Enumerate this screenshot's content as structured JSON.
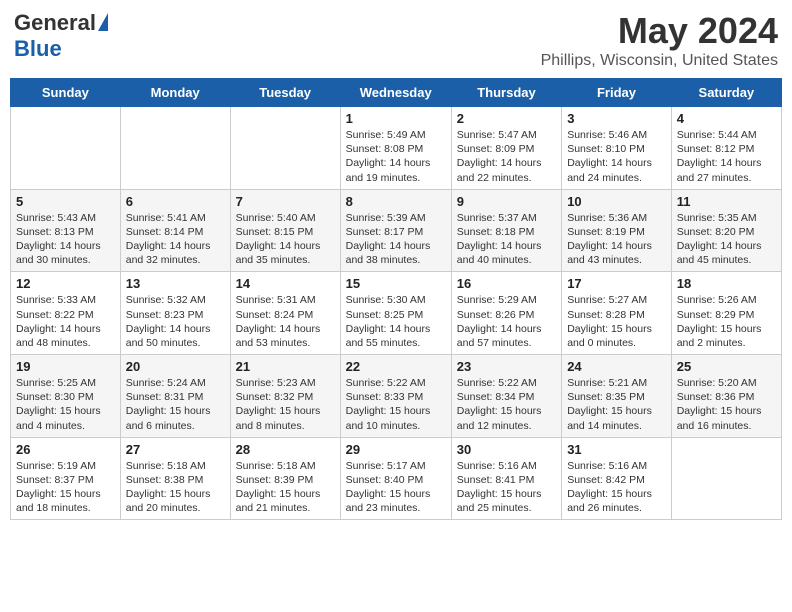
{
  "header": {
    "logo_general": "General",
    "logo_blue": "Blue",
    "month_year": "May 2024",
    "location": "Phillips, Wisconsin, United States"
  },
  "days_of_week": [
    "Sunday",
    "Monday",
    "Tuesday",
    "Wednesday",
    "Thursday",
    "Friday",
    "Saturday"
  ],
  "weeks": [
    [
      {
        "day": "",
        "info": ""
      },
      {
        "day": "",
        "info": ""
      },
      {
        "day": "",
        "info": ""
      },
      {
        "day": "1",
        "info": "Sunrise: 5:49 AM\nSunset: 8:08 PM\nDaylight: 14 hours and 19 minutes."
      },
      {
        "day": "2",
        "info": "Sunrise: 5:47 AM\nSunset: 8:09 PM\nDaylight: 14 hours and 22 minutes."
      },
      {
        "day": "3",
        "info": "Sunrise: 5:46 AM\nSunset: 8:10 PM\nDaylight: 14 hours and 24 minutes."
      },
      {
        "day": "4",
        "info": "Sunrise: 5:44 AM\nSunset: 8:12 PM\nDaylight: 14 hours and 27 minutes."
      }
    ],
    [
      {
        "day": "5",
        "info": "Sunrise: 5:43 AM\nSunset: 8:13 PM\nDaylight: 14 hours and 30 minutes."
      },
      {
        "day": "6",
        "info": "Sunrise: 5:41 AM\nSunset: 8:14 PM\nDaylight: 14 hours and 32 minutes."
      },
      {
        "day": "7",
        "info": "Sunrise: 5:40 AM\nSunset: 8:15 PM\nDaylight: 14 hours and 35 minutes."
      },
      {
        "day": "8",
        "info": "Sunrise: 5:39 AM\nSunset: 8:17 PM\nDaylight: 14 hours and 38 minutes."
      },
      {
        "day": "9",
        "info": "Sunrise: 5:37 AM\nSunset: 8:18 PM\nDaylight: 14 hours and 40 minutes."
      },
      {
        "day": "10",
        "info": "Sunrise: 5:36 AM\nSunset: 8:19 PM\nDaylight: 14 hours and 43 minutes."
      },
      {
        "day": "11",
        "info": "Sunrise: 5:35 AM\nSunset: 8:20 PM\nDaylight: 14 hours and 45 minutes."
      }
    ],
    [
      {
        "day": "12",
        "info": "Sunrise: 5:33 AM\nSunset: 8:22 PM\nDaylight: 14 hours and 48 minutes."
      },
      {
        "day": "13",
        "info": "Sunrise: 5:32 AM\nSunset: 8:23 PM\nDaylight: 14 hours and 50 minutes."
      },
      {
        "day": "14",
        "info": "Sunrise: 5:31 AM\nSunset: 8:24 PM\nDaylight: 14 hours and 53 minutes."
      },
      {
        "day": "15",
        "info": "Sunrise: 5:30 AM\nSunset: 8:25 PM\nDaylight: 14 hours and 55 minutes."
      },
      {
        "day": "16",
        "info": "Sunrise: 5:29 AM\nSunset: 8:26 PM\nDaylight: 14 hours and 57 minutes."
      },
      {
        "day": "17",
        "info": "Sunrise: 5:27 AM\nSunset: 8:28 PM\nDaylight: 15 hours and 0 minutes."
      },
      {
        "day": "18",
        "info": "Sunrise: 5:26 AM\nSunset: 8:29 PM\nDaylight: 15 hours and 2 minutes."
      }
    ],
    [
      {
        "day": "19",
        "info": "Sunrise: 5:25 AM\nSunset: 8:30 PM\nDaylight: 15 hours and 4 minutes."
      },
      {
        "day": "20",
        "info": "Sunrise: 5:24 AM\nSunset: 8:31 PM\nDaylight: 15 hours and 6 minutes."
      },
      {
        "day": "21",
        "info": "Sunrise: 5:23 AM\nSunset: 8:32 PM\nDaylight: 15 hours and 8 minutes."
      },
      {
        "day": "22",
        "info": "Sunrise: 5:22 AM\nSunset: 8:33 PM\nDaylight: 15 hours and 10 minutes."
      },
      {
        "day": "23",
        "info": "Sunrise: 5:22 AM\nSunset: 8:34 PM\nDaylight: 15 hours and 12 minutes."
      },
      {
        "day": "24",
        "info": "Sunrise: 5:21 AM\nSunset: 8:35 PM\nDaylight: 15 hours and 14 minutes."
      },
      {
        "day": "25",
        "info": "Sunrise: 5:20 AM\nSunset: 8:36 PM\nDaylight: 15 hours and 16 minutes."
      }
    ],
    [
      {
        "day": "26",
        "info": "Sunrise: 5:19 AM\nSunset: 8:37 PM\nDaylight: 15 hours and 18 minutes."
      },
      {
        "day": "27",
        "info": "Sunrise: 5:18 AM\nSunset: 8:38 PM\nDaylight: 15 hours and 20 minutes."
      },
      {
        "day": "28",
        "info": "Sunrise: 5:18 AM\nSunset: 8:39 PM\nDaylight: 15 hours and 21 minutes."
      },
      {
        "day": "29",
        "info": "Sunrise: 5:17 AM\nSunset: 8:40 PM\nDaylight: 15 hours and 23 minutes."
      },
      {
        "day": "30",
        "info": "Sunrise: 5:16 AM\nSunset: 8:41 PM\nDaylight: 15 hours and 25 minutes."
      },
      {
        "day": "31",
        "info": "Sunrise: 5:16 AM\nSunset: 8:42 PM\nDaylight: 15 hours and 26 minutes."
      },
      {
        "day": "",
        "info": ""
      }
    ]
  ]
}
